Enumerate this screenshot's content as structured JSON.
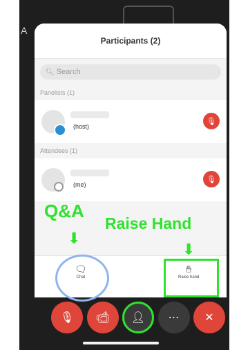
{
  "panel": {
    "title": "Participants (2)",
    "search_placeholder": "Search",
    "panelists_header": "Panelists (1)",
    "attendees_header": "Attendees (1)",
    "panelist": {
      "role": "(host)"
    },
    "attendee": {
      "role": "(me)"
    }
  },
  "actions": {
    "chat_label": "Chat",
    "raise_hand_label": "Raise hand"
  },
  "annotations": {
    "qa_label": "Q&A",
    "raise_hand_label": "Raise Hand"
  },
  "toolbar": {
    "buttons": [
      "mic-muted",
      "video-off",
      "participants",
      "more",
      "leave"
    ]
  },
  "colors": {
    "annotation_green": "#2ee22e",
    "mute_red": "#e0453a",
    "qa_circle_blue": "#8fb4ee"
  },
  "backdrop": {
    "corner_letter": "A"
  }
}
